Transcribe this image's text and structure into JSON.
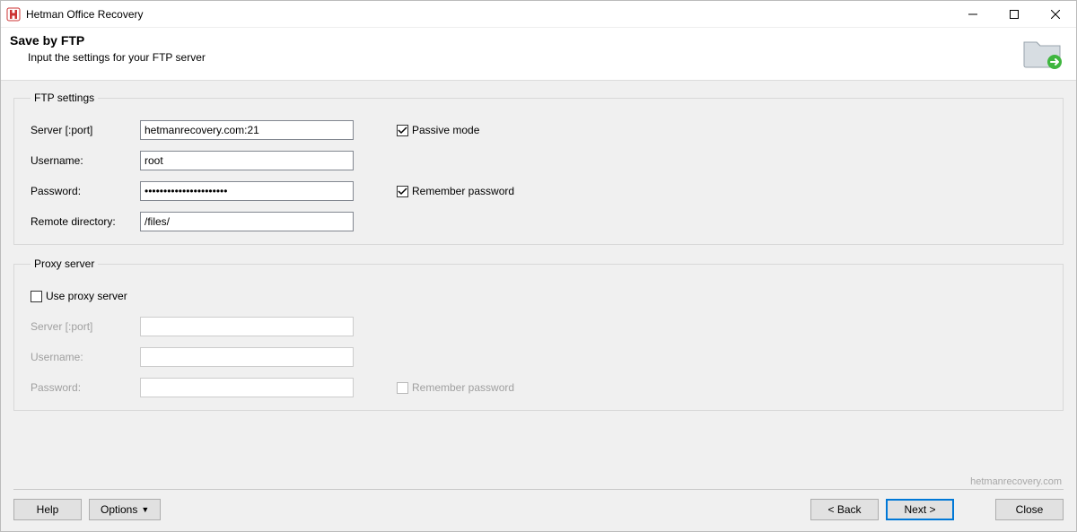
{
  "app": {
    "title": "Hetman Office Recovery"
  },
  "header": {
    "title": "Save by FTP",
    "subtitle": "Input the settings for your FTP server"
  },
  "ftp": {
    "legend": "FTP settings",
    "server_label": "Server [:port]",
    "server_value": "hetmanrecovery.com:21",
    "passive_label": "Passive mode",
    "username_label": "Username:",
    "username_value": "root",
    "password_label": "Password:",
    "password_value": "••••••••••••••••••••••",
    "remember_label": "Remember password",
    "remote_label": "Remote directory:",
    "remote_value": "/files/"
  },
  "proxy": {
    "legend": "Proxy server",
    "use_label": "Use proxy server",
    "server_label": "Server [:port]",
    "server_value": "",
    "username_label": "Username:",
    "username_value": "",
    "password_label": "Password:",
    "password_value": "",
    "remember_label": "Remember password"
  },
  "footer": {
    "brand": "hetmanrecovery.com",
    "help": "Help",
    "options": "Options",
    "back": "< Back",
    "next": "Next >",
    "close": "Close"
  }
}
